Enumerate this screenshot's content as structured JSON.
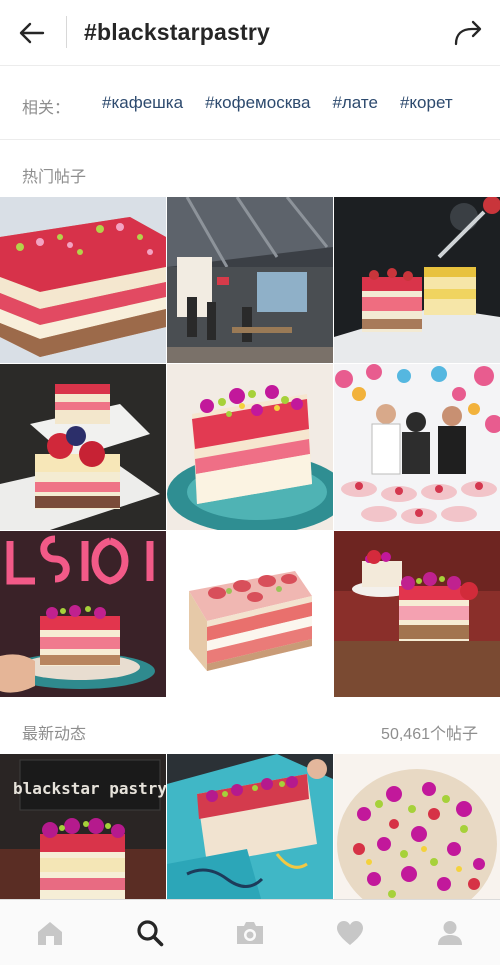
{
  "header": {
    "title": "#blackstarpastry",
    "back_icon": "arrow-left-icon",
    "share_icon": "share-arrow-icon"
  },
  "related": {
    "label": "相关：",
    "tags": [
      "#кафешка",
      "#кофемосква",
      "#лате",
      "#корет"
    ]
  },
  "top_posts": {
    "title": "热门帖子",
    "items": [
      "strawberry watermelon cake slab",
      "cafe interior",
      "cake slices on plate with fork",
      "cake slices with raspberries",
      "cake slice with rose petals on teal plate",
      "bakers with cakes",
      "hand holding cake slice",
      "illustrated cake slice",
      "cake slice on wooden table"
    ]
  },
  "recent": {
    "title": "最新动态",
    "count": "50,461个帖子",
    "items": [
      "cake slice under black star pastry sign",
      "cake in blue box",
      "rose petal and pistachio topping"
    ],
    "sign_text": "blackstar pastry"
  },
  "bottom_nav": {
    "items": [
      "home-icon",
      "search-icon",
      "camera-icon",
      "heart-icon",
      "profile-icon"
    ],
    "active": "search-icon"
  },
  "colors": {
    "tag": "#2d4a6e",
    "muted": "#8e8e8e",
    "nav_inactive": "#c7c7c7",
    "nav_active": "#262626"
  }
}
